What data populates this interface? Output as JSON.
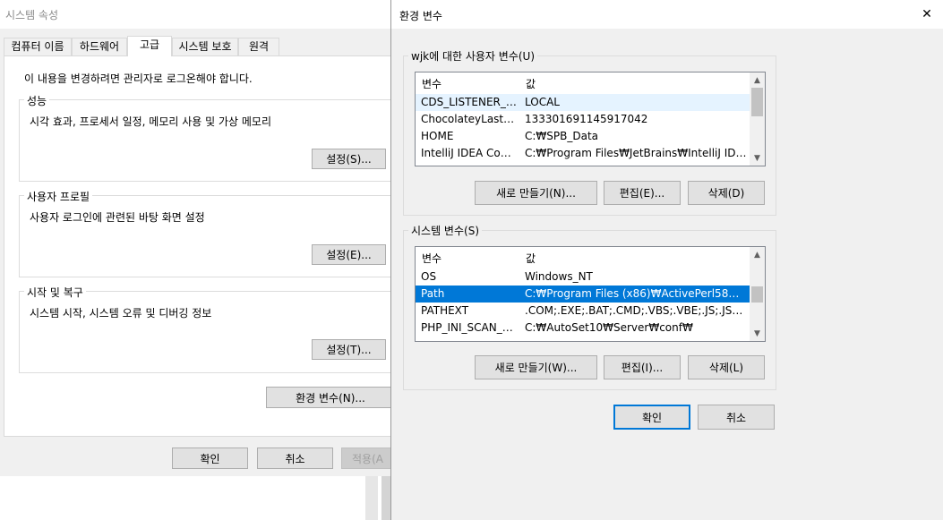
{
  "bg_window": {
    "title": "시스템 속성",
    "tabs": [
      {
        "label": "컴퓨터 이름"
      },
      {
        "label": "하드웨어"
      },
      {
        "label": "고급"
      },
      {
        "label": "시스템 보호"
      },
      {
        "label": "원격"
      }
    ],
    "admin_note": "이 내용을 변경하려면 관리자로 로그온해야 합니다.",
    "performance": {
      "title": "성능",
      "desc": "시각 효과, 프로세서 일정, 메모리 사용 및 가상 메모리",
      "button": "설정(S)..."
    },
    "user_profiles": {
      "title": "사용자 프로필",
      "desc": "사용자 로그인에 관련된 바탕 화면 설정",
      "button": "설정(E)..."
    },
    "startup_recovery": {
      "title": "시작 및 복구",
      "desc": "시스템 시작, 시스템 오류 및 디버깅 정보",
      "button": "설정(T)..."
    },
    "env_button": "환경 변수(N)...",
    "ok": "확인",
    "cancel": "취소",
    "apply": "적용(A"
  },
  "env_dialog": {
    "title": "환경 변수",
    "close_glyph": "✕",
    "user_vars": {
      "legend": "wjk에 대한 사용자 변수(U)",
      "col_var": "변수",
      "col_val": "값",
      "rows": [
        {
          "name": "CDS_LISTENER_M...",
          "value": "LOCAL"
        },
        {
          "name": "ChocolateyLastPat...",
          "value": "133301691145917042"
        },
        {
          "name": "HOME",
          "value": "C:₩SPB_Data"
        },
        {
          "name": "IntelliJ IDEA Com...",
          "value": "C:₩Program Files₩JetBrains₩IntelliJ IDEA C..."
        }
      ],
      "new": "새로 만들기(N)...",
      "edit": "편집(E)...",
      "delete": "삭제(D)"
    },
    "sys_vars": {
      "legend": "시스템 변수(S)",
      "col_var": "변수",
      "col_val": "값",
      "rows": [
        {
          "name": "OS",
          "value": "Windows_NT"
        },
        {
          "name": "Path",
          "value": "C:₩Program Files (x86)₩ActivePerl58₩bin..."
        },
        {
          "name": "PATHEXT",
          "value": ".COM;.EXE;.BAT;.CMD;.VBS;.VBE;.JS;.JSE;.W..."
        },
        {
          "name": "PHP_INI_SCAN_DIR",
          "value": "C:₩AutoSet10₩Server₩conf₩"
        }
      ],
      "new": "새로 만들기(W)...",
      "edit": "편집(I)...",
      "delete": "삭제(L)"
    },
    "ok": "확인",
    "cancel": "취소"
  },
  "colors": {
    "accent": "#0078d7",
    "dialog_bg": "#f0f0f0",
    "title_bg": "#ffffff"
  }
}
